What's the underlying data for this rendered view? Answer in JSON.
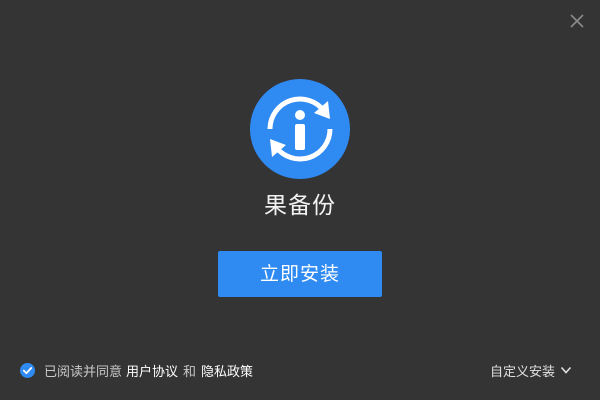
{
  "app": {
    "name": "果备份"
  },
  "install": {
    "label": "立即安装"
  },
  "footer": {
    "agree_text": "已阅读并同意",
    "user_agreement": "用户协议",
    "and": "和",
    "privacy_policy": "隐私政策",
    "custom_install": "自定义安装"
  },
  "colors": {
    "background": "#343434",
    "accent": "#2f8af2"
  },
  "icons": {
    "close": "close-icon",
    "logo": "info-sync-logo",
    "checkbox": "checkmark-icon",
    "dropdown": "chevron-down-icon"
  }
}
